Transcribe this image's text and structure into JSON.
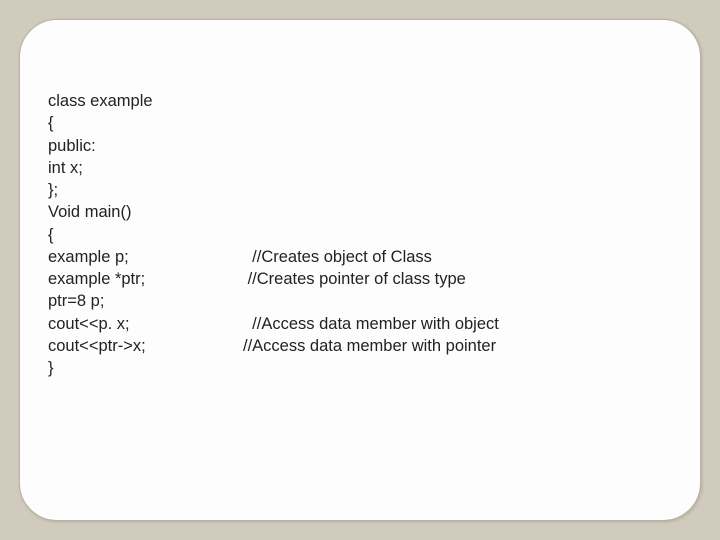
{
  "lines": [
    {
      "left": "class example",
      "right": ""
    },
    {
      "left": "{",
      "right": ""
    },
    {
      "left": "public:",
      "right": ""
    },
    {
      "left": "int x;",
      "right": ""
    },
    {
      "left": "};",
      "right": ""
    },
    {
      "left": "Void main()",
      "right": ""
    },
    {
      "left": "{",
      "right": ""
    },
    {
      "left": "example p;",
      "right": "  //Creates object of Class"
    },
    {
      "left": "example *ptr;",
      "right": " //Creates pointer of class type"
    },
    {
      "left": "ptr=8 p;",
      "right": ""
    },
    {
      "left": "cout<<p. x;",
      "right": "  //Access data member with object"
    },
    {
      "left": "cout<<ptr->x;",
      "right": "//Access data member with pointer"
    },
    {
      "left": "}",
      "right": ""
    }
  ]
}
